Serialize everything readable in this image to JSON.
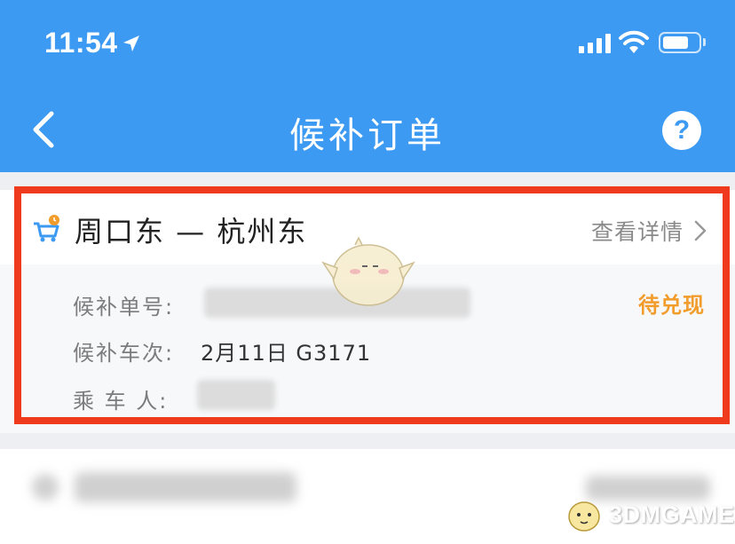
{
  "status_bar": {
    "time": "11:54"
  },
  "nav": {
    "title": "候补订单",
    "help_label": "?"
  },
  "order": {
    "route": "周口东 — 杭州东",
    "detail_label": "查看详情",
    "status": "待兑现",
    "rows": [
      {
        "label": "候补单号:",
        "value": ""
      },
      {
        "label": "候补车次:",
        "value": "2月11日  G3171"
      },
      {
        "label": "乘  车  人:",
        "value": ""
      }
    ]
  },
  "watermark": {
    "text": "3DMGAME"
  },
  "colors": {
    "nav_bg": "#3d9af2",
    "status_orange": "#f29c2b",
    "highlight_red": "#f03a1e"
  }
}
